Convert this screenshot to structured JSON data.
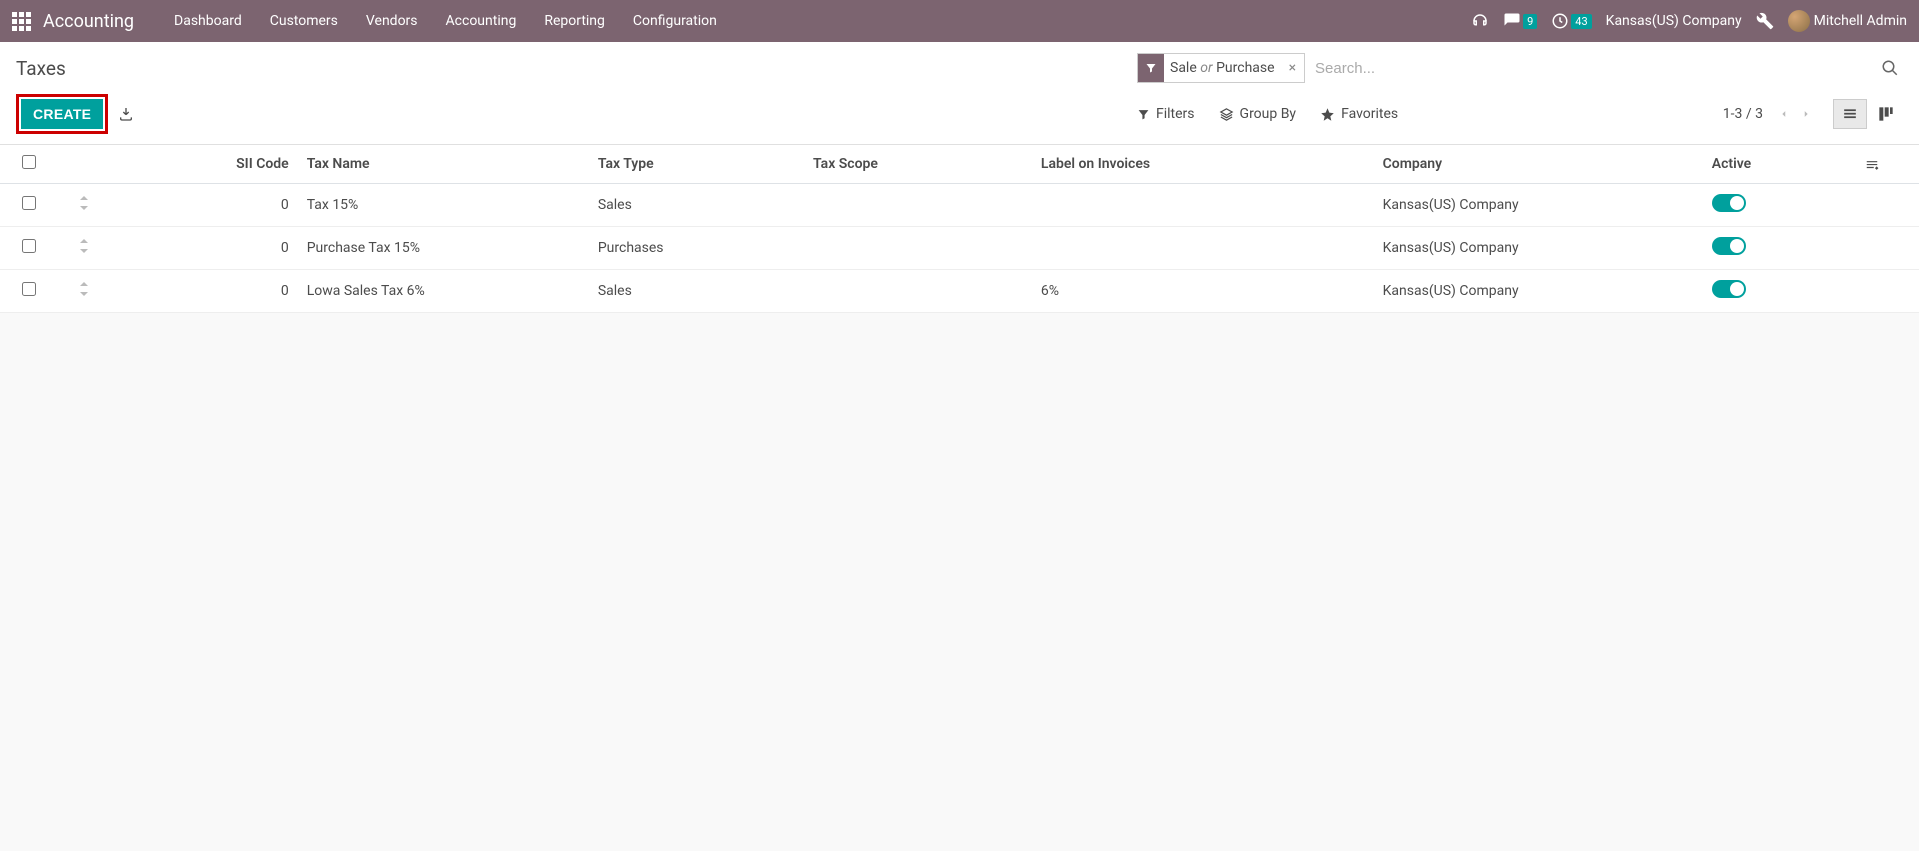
{
  "nav": {
    "brand": "Accounting",
    "links": [
      "Dashboard",
      "Customers",
      "Vendors",
      "Accounting",
      "Reporting",
      "Configuration"
    ],
    "msg_badge": "9",
    "clock_badge": "43",
    "company": "Kansas(US) Company",
    "user": "Mitchell Admin"
  },
  "cp": {
    "title": "Taxes",
    "facet_parts": {
      "a": "Sale",
      "or": "or",
      "b": "Purchase"
    },
    "search_placeholder": "Search...",
    "create": "CREATE",
    "filters": "Filters",
    "groupby": "Group By",
    "favorites": "Favorites",
    "pager": "1-3 / 3"
  },
  "table": {
    "headers": {
      "sii": "SII Code",
      "name": "Tax Name",
      "type": "Tax Type",
      "scope": "Tax Scope",
      "label": "Label on Invoices",
      "company": "Company",
      "active": "Active"
    },
    "rows": [
      {
        "sii": "0",
        "name": "Tax 15%",
        "type": "Sales",
        "scope": "",
        "label": "",
        "company": "Kansas(US) Company",
        "active": true
      },
      {
        "sii": "0",
        "name": "Purchase Tax 15%",
        "type": "Purchases",
        "scope": "",
        "label": "",
        "company": "Kansas(US) Company",
        "active": true
      },
      {
        "sii": "0",
        "name": "Lowa Sales Tax 6%",
        "type": "Sales",
        "scope": "",
        "label": "6%",
        "company": "Kansas(US) Company",
        "active": true
      }
    ]
  }
}
